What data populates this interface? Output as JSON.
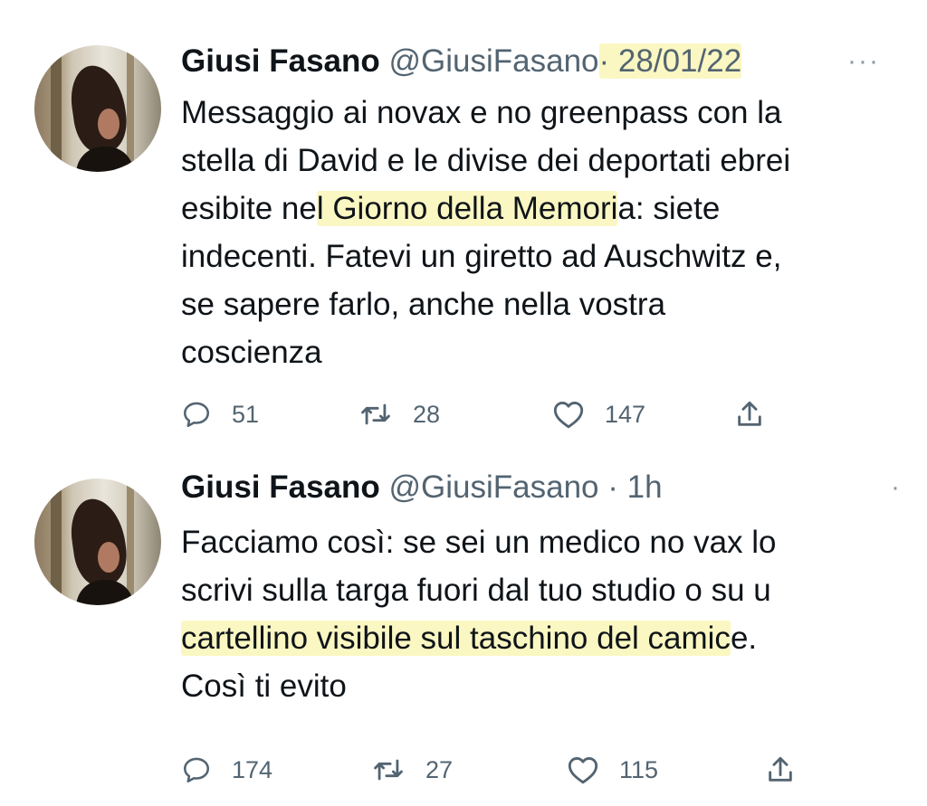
{
  "tweets": [
    {
      "author_name": "Giusi Fasano",
      "handle": "@GiusiFasano",
      "separator": "·",
      "time": "28/01/22",
      "more": "···",
      "text_lines": [
        [
          "Messaggio ai novax e no greenpass con la"
        ],
        [
          "stella di David e le divise dei deportati ebrei"
        ],
        [
          "esibite ne",
          "l Giorno della Memori",
          "a: siete"
        ],
        [
          "indecenti. Fatevi un giretto ad Auschwitz e,"
        ],
        [
          "se sapere farlo, anche nella vostra"
        ],
        [
          "coscienza"
        ]
      ],
      "replies": "51",
      "retweets": "28",
      "likes": "147"
    },
    {
      "author_name": "Giusi Fasano",
      "handle": "@GiusiFasano",
      "separator": "·",
      "time": "1h",
      "more": "·",
      "text_lines": [
        [
          "Facciamo così: se sei un medico no vax lo"
        ],
        [
          "scrivi sulla targa fuori dal tuo studio o su u"
        ],
        [
          "",
          "cartellino visibile sul taschino del camic",
          "e."
        ],
        [
          "Così ti evito"
        ]
      ],
      "replies": "174",
      "retweets": "27",
      "likes": "115"
    }
  ],
  "icons": [
    "reply-icon",
    "retweet-icon",
    "like-icon",
    "share-icon"
  ],
  "colors": {
    "text": "#0f1419",
    "muted": "#536471",
    "highlight": "#fbf7c2"
  }
}
